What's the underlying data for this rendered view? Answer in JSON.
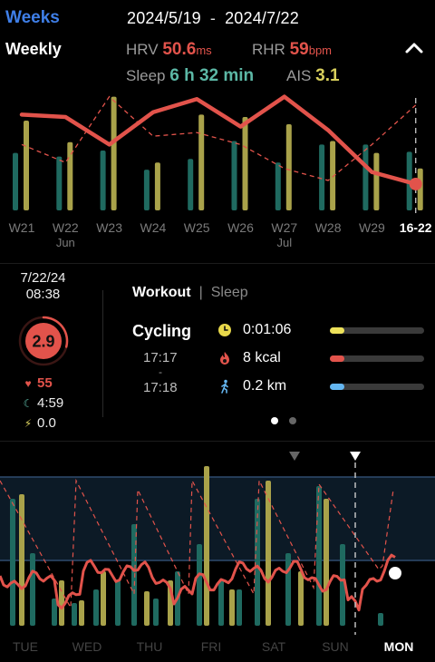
{
  "header": {
    "period_tab": "Weeks",
    "date_start": "2024/5/19",
    "date_sep": "-",
    "date_end": "2024/7/22"
  },
  "summary": {
    "period_label": "Weekly",
    "hrv_label": "HRV",
    "hrv_value": "50.6",
    "hrv_unit": "ms",
    "rhr_label": "RHR",
    "rhr_value": "59",
    "rhr_unit": "bpm",
    "sleep_label": "Sleep",
    "sleep_value": "6 h 32 min",
    "ais_label": "AIS",
    "ais_value": "3.1"
  },
  "weekly_chart": {
    "x_labels": [
      "W21",
      "W22",
      "W23",
      "W24",
      "W25",
      "W26",
      "W27",
      "W28",
      "W29",
      "16-22"
    ],
    "x_sublabels": [
      "",
      "Jun",
      "",
      "",
      "",
      "",
      "Jul",
      "",
      "",
      ""
    ],
    "selected_index": 9,
    "hrv_line": [
      80,
      78,
      55,
      82,
      93,
      70,
      95,
      67,
      32,
      22
    ],
    "rhr_dashed": [
      55,
      40,
      95,
      62,
      65,
      55,
      35,
      25,
      55,
      88
    ],
    "teal_bars": [
      48,
      45,
      50,
      34,
      43,
      58,
      40,
      55,
      55,
      49
    ],
    "yellow_bars": [
      75,
      57,
      95,
      40,
      80,
      78,
      72,
      58,
      48,
      35
    ]
  },
  "detail": {
    "date": "7/22/24",
    "time": "08:38",
    "ais_score": "2.9",
    "ais_progress": 0.29,
    "heart_rate": "55",
    "sleep_duration": "4:59",
    "energy": "0.0",
    "tab_workout": "Workout",
    "tab_sep": "|",
    "tab_sleep": "Sleep",
    "activity": "Cycling",
    "start_time": "17:17",
    "dash": "-",
    "end_time": "17:18",
    "duration": "0:01:06",
    "calories": "8 kcal",
    "distance": "0.2 km",
    "duration_fill": 0.15,
    "calories_fill": 0.15,
    "distance_fill": 0.15,
    "page_count": 2,
    "page_index": 0
  },
  "daily_chart": {
    "x_labels": [
      "TUE",
      "WED",
      "THU",
      "FRI",
      "SAT",
      "SUN",
      "MON"
    ],
    "selected_index": 6
  },
  "colors": {
    "accent_blue": "#3f7fe8",
    "hrv_red": "#e2534b",
    "sleep_teal": "#5cb8a6",
    "ais_yellow": "#d8cf5c",
    "bar_teal": "#1f6a60",
    "bar_yellow": "#a9a24a",
    "band": "#0c1a26",
    "band_line": "#2e4b6e",
    "distance_blue": "#64b6f0"
  }
}
